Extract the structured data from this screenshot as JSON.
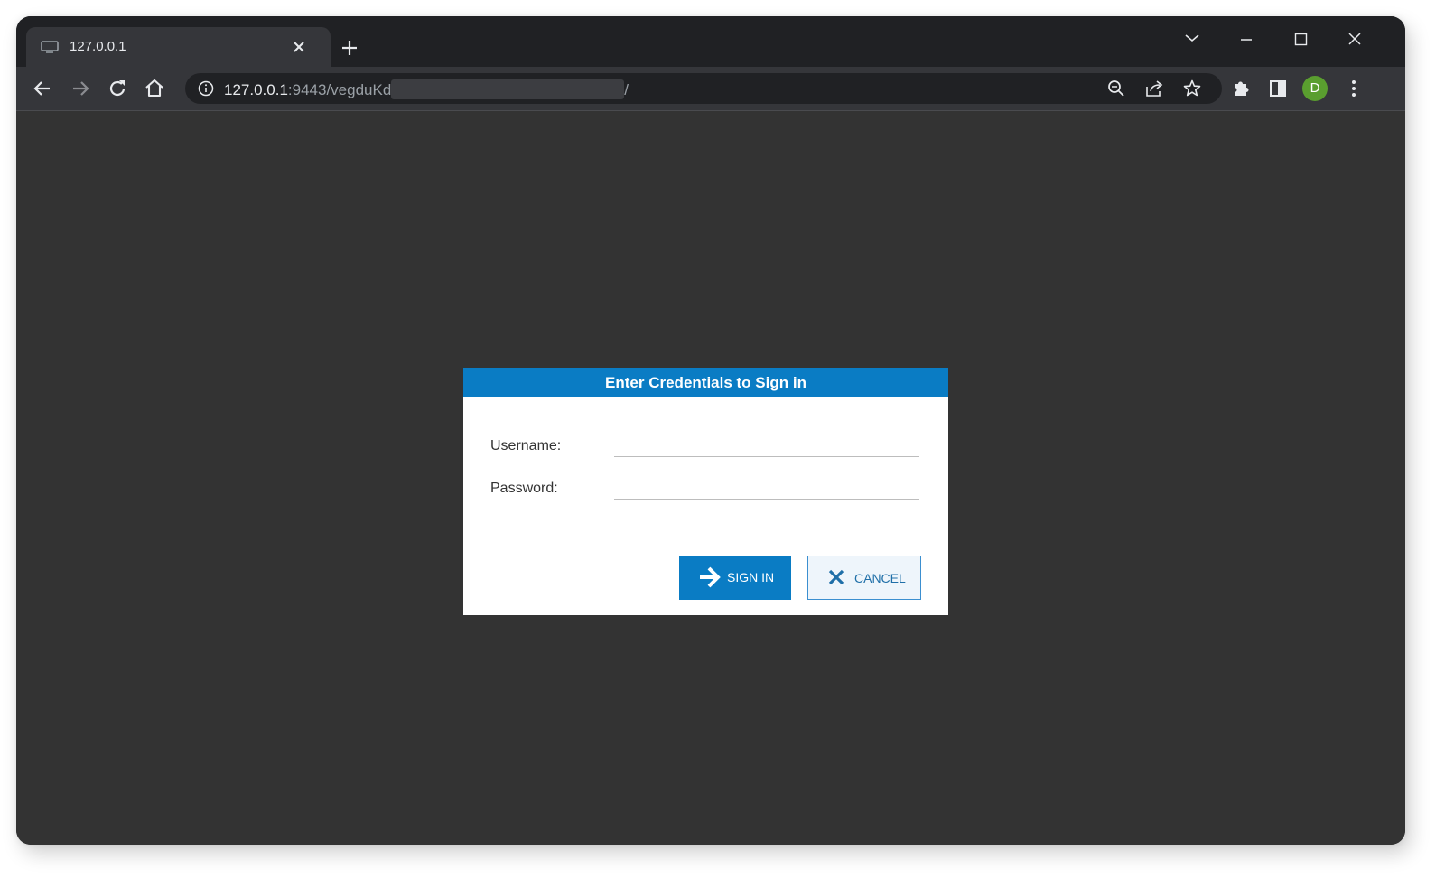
{
  "browser": {
    "tab": {
      "title": "127.0.0.1"
    },
    "address_bar": {
      "host": "127.0.0.1",
      "path_start": ":9443/vegduKd",
      "path_end": "/"
    },
    "profile": {
      "initial": "D",
      "color": "#5a9e2f"
    },
    "icons": {
      "favicon": "monitor-icon",
      "tab_close": "close-icon",
      "new_tab": "plus-icon",
      "tab_search": "chevron-down-icon",
      "minimize": "minimize-icon",
      "maximize": "maximize-icon",
      "close_window": "close-icon",
      "back": "arrow-left-icon",
      "forward": "arrow-right-icon",
      "reload": "reload-icon",
      "home": "home-icon",
      "site_info": "info-icon",
      "zoom": "zoom-out-icon",
      "share": "share-icon",
      "bookmark": "star-icon",
      "extensions": "puzzle-icon",
      "side_panel": "side-panel-icon",
      "menu": "kebab-menu-icon"
    }
  },
  "dialog": {
    "title": "Enter Credentials to Sign in",
    "username_label": "Username:",
    "username_value": "",
    "password_label": "Password:",
    "password_value": "",
    "sign_in_label": "SIGN IN",
    "cancel_label": "CANCEL"
  },
  "colors": {
    "accent": "#0a7cc4",
    "content_background": "#333333",
    "browser_frame": "#202124",
    "toolbar": "#35363a"
  }
}
